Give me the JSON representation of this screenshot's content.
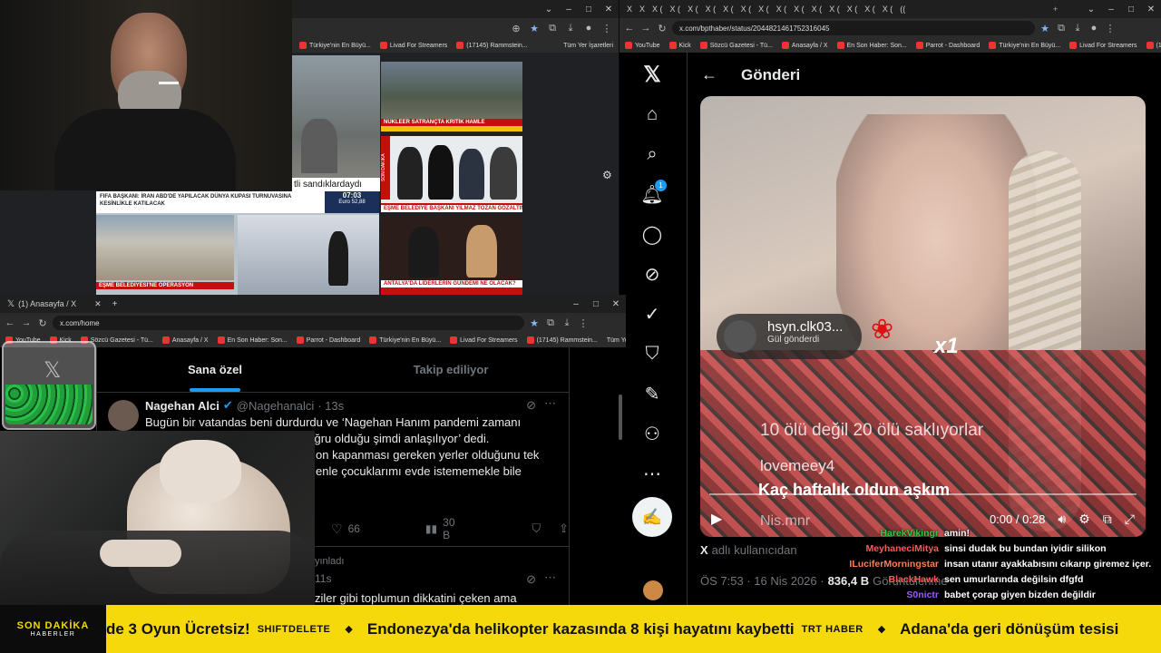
{
  "right_browser": {
    "tabs": [
      "X",
      "X",
      "X (",
      "X (",
      "X (",
      "X (",
      "X (",
      "X (",
      "X (",
      "X (",
      "X (",
      "X (",
      "X (",
      "X (",
      "X (",
      "X (",
      "(("
    ],
    "url": "x.com/bpthaber/status/2044821461752316045",
    "bookmarks": [
      "YouTube",
      "Kick",
      "Sözcü Gazetesi - Tü...",
      "Anasayfa / X",
      "En Son Haber: Son...",
      "Parrot - Dashboard",
      "Türkiye'nin En Büyü...",
      "Livad For Streamers",
      "(17145) Rammstein..."
    ],
    "all_bookmarks": "Tüm Yer İşaretleri"
  },
  "x_post": {
    "header": "Gönderi",
    "notification_count": "1",
    "video": {
      "gift_user": "hsyn.clk03...",
      "gift_label": "Gül gönderdi",
      "gift_count": "x1",
      "caption1": "10 ölü değil 20 ölü saklıyorlar",
      "caption2_user": "lovemeey4",
      "caption2": "Kaç haftalık oldun aşkım",
      "caption3": "Nis.mnr",
      "time": "0:00 / 0:28"
    },
    "author": "adlı kullanıcıdan",
    "meta_time": "ÖS 7:53 · 16 Nis 2026 ·",
    "views": "836,4 B",
    "views_label": "Görüntülenme"
  },
  "chat": [
    {
      "name": "HarekVikingr",
      "color": "#2ecc40",
      "msg": "amin!"
    },
    {
      "name": "MeyhaneciMitya",
      "color": "#ff5a5a",
      "msg": "sinsi dudak bu bundan iyidir silikon"
    },
    {
      "name": "ILuciferMorningstar",
      "color": "#ff7f50",
      "msg": "insan utanır ayakkabısını cıkarıp giremez içer."
    },
    {
      "name": "BlackHawk",
      "color": "#ff5a5a",
      "msg": "sen umurlarında değilsin dfgfd"
    },
    {
      "name": "S0nictr",
      "color": "#9b59ff",
      "msg": "babet çorap giyen bizden değildir"
    }
  ],
  "left_bottom_browser": {
    "tab_title": "(1) Anasayfa / X",
    "url": "x.com/home",
    "bookmarks": [
      "YouTube",
      "Kick",
      "Sözcü Gazetesi - Tü...",
      "Anasayfa / X",
      "En Son Haber: Son...",
      "Parrot - Dashboard",
      "Türkiye'nin En Büyü...",
      "Livad For Streamers",
      "(17145) Rammstein..."
    ],
    "all_bookmarks": "Tüm Yer İşaretleri",
    "tab_for_you": "Sana özel",
    "tab_following": "Takip ediliyor",
    "tweet": {
      "name": "Nagehan Alci",
      "handle": "@Nagehanalci",
      "time": "· 13s",
      "line1": "Bugün bir vatandas beni durdurdu ve ‘Nagehan Hanım pandemi zamanı",
      "line2": "doğru  olduğu şimdi anlaşılıyor’ dedi.",
      "line3": "on kapanması gereken yerler olduğunu tek",
      "line4": "enle çocuklarımı evde istememekle bile",
      "likes": "66",
      "views": "30 B"
    },
    "tweet2": {
      "repost_label": "yınladı",
      "time": "11s",
      "line1": "ziler gibi toplumun dikkatini çeken ama"
    }
  },
  "left_top_browser": {
    "bookmarks": [
      "Türkiye'nin En Büyü...",
      "Livad For Streamers",
      "(17145) Rammstein..."
    ],
    "all_bookmarks": "Tüm Yer İşaretleri"
  },
  "news": {
    "tile_subtitle": "tli sandıklardaydı",
    "headline_nuclear": "NÜKLEER SATRANÇTA KRİTİK HAMLE",
    "son_dakika": "SON DAKİKA",
    "headline_esme": "EŞME BELEDİYE BAŞKANI YILMAZ TOZAN GÖZALTINDA",
    "headline_fifa": "FIFA BAŞKANI: İRAN ABD'DE YAPILACAK DÜNYA KUPASI TURNUVASINA KESİNLİKLE KATILACAK",
    "fifa_time": "07:03",
    "fifa_euro": "Euro  52,88",
    "headline_esme_op": "EŞME BELEDİYESİ'NE OPERASYON",
    "headline_antalya": "ANTALYA'DA LİDERLERİN GÜNDEMİ NE OLACAK?"
  },
  "ticker": {
    "logo_line1": "SON DAKİKA",
    "logo_line2": "HABERLER",
    "items": [
      {
        "text": "de 3 Oyun Ücretsiz!",
        "source": "SHIFTDELETE"
      },
      {
        "text": "Endonezya'da helikopter kazasında 8 kişi hayatını kaybetti",
        "source": "TRT HABER"
      },
      {
        "text": "Adana'da geri dönüşüm tesisi",
        "source": ""
      }
    ],
    "separator": "◆"
  },
  "colors": {
    "ticker_bg": "#f5d90a",
    "x_blue": "#1d9bf0",
    "x_bg": "#000000"
  }
}
